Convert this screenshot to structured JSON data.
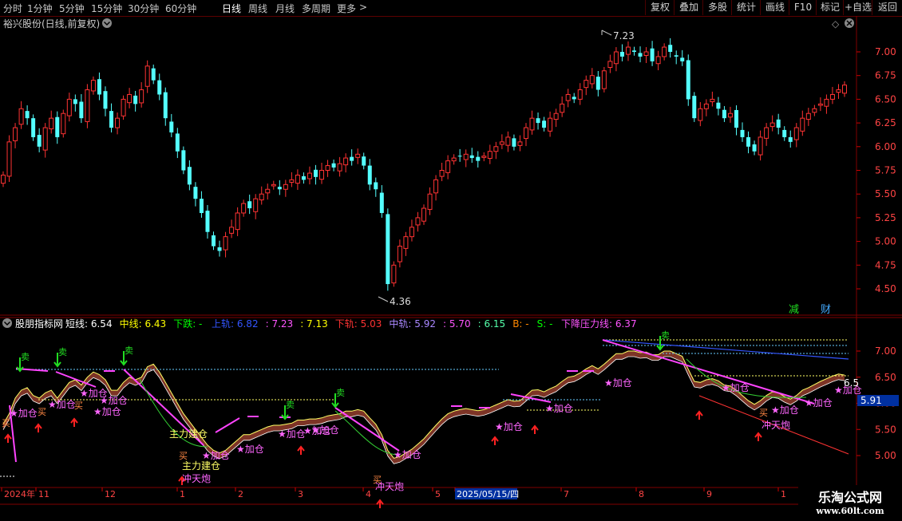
{
  "toolbar": {
    "periods": [
      "分时",
      "1分钟",
      "5分钟",
      "15分钟",
      "30分钟",
      "60分钟",
      "日线",
      "周线",
      "月线",
      "多周期",
      "更多"
    ],
    "active_period": "日线",
    "more_arrow": ">",
    "right_buttons": [
      "复权",
      "叠加",
      "多股",
      "统计",
      "画线",
      "F10",
      "标记",
      "+自选",
      "返回"
    ]
  },
  "main_panel": {
    "title": "裕兴股份(日线,前复权)",
    "high_label": "7.23",
    "low_label": "4.36",
    "axis_ticks": [
      "7.00",
      "6.75",
      "6.50",
      "6.25",
      "6.00",
      "5.75",
      "5.50",
      "5.25",
      "5.00",
      "4.75",
      "4.50"
    ],
    "markers": [
      {
        "text": "减",
        "color": "#22dd22"
      },
      {
        "text": "财",
        "color": "#44aaff"
      }
    ]
  },
  "indicator_panel": {
    "name": "股朋指标网",
    "legend": [
      {
        "label": "短线:",
        "value": "6.54",
        "color": "#ffffff"
      },
      {
        "label": "中线:",
        "value": "6.43",
        "color": "#ffff00"
      },
      {
        "label": "下跌:",
        "value": "-",
        "color": "#00ff00"
      },
      {
        "label": "上轨:",
        "value": "6.82",
        "color": "#3355ff"
      },
      {
        "label": ":",
        "value": "7.23",
        "color": "#ff55ff"
      },
      {
        "label": ":",
        "value": "7.13",
        "color": "#ffff00"
      },
      {
        "label": "下轨:",
        "value": "5.03",
        "color": "#ff3333"
      },
      {
        "label": "中轨:",
        "value": "5.92",
        "color": "#aa88ff"
      },
      {
        "label": ":",
        "value": "5.70",
        "color": "#ff55ff"
      },
      {
        "label": ":",
        "value": "6.15",
        "color": "#55ffaa"
      },
      {
        "label": "B:",
        "value": "-",
        "color": "#ff8800"
      },
      {
        "label": "S:",
        "value": "-",
        "color": "#00ff00"
      },
      {
        "label": "下降压力线:",
        "value": "6.37",
        "color": "#ff55ff"
      }
    ],
    "axis_ticks": [
      "7.00",
      "6.50",
      "6.00",
      "5.50",
      "5.00"
    ],
    "current_value": "6.5",
    "cursor_value": "5.91",
    "signals": {
      "sell": "卖",
      "buy": "买",
      "add": "★加仓",
      "build": "主力建仓",
      "rocket": "冲天炮"
    }
  },
  "time_axis": {
    "labels": [
      "2024年",
      "11",
      "12",
      "1",
      "2",
      "3",
      "4",
      "5",
      "2025/05/15/四",
      "7",
      "8",
      "9",
      "1"
    ]
  },
  "watermark": {
    "title": "乐淘公式网",
    "url": "www.60lt.com"
  },
  "colors": {
    "up": "#ff3333",
    "down": "#54ffff",
    "grid": "#800000",
    "background": "#000000"
  },
  "chart_data": {
    "type": "candlestick",
    "title": "裕兴股份(日线,前复权)",
    "ylim": [
      4.3,
      7.3
    ],
    "high": 7.23,
    "low": 4.36,
    "series": [
      {
        "name": "close",
        "values": [
          5.7,
          6.05,
          6.2,
          6.4,
          6.3,
          6.1,
          6.0,
          6.2,
          6.3,
          6.1,
          6.35,
          6.5,
          6.45,
          6.3,
          6.6,
          6.7,
          6.55,
          6.4,
          6.2,
          6.3,
          6.5,
          6.55,
          6.45,
          6.6,
          6.85,
          6.7,
          6.55,
          6.3,
          6.15,
          5.95,
          5.75,
          5.6,
          5.45,
          5.3,
          5.1,
          4.95,
          4.9,
          5.05,
          5.15,
          5.3,
          5.4,
          5.35,
          5.45,
          5.5,
          5.55,
          5.6,
          5.55,
          5.6,
          5.65,
          5.7,
          5.65,
          5.72,
          5.68,
          5.75,
          5.8,
          5.78,
          5.82,
          5.88,
          5.85,
          5.92,
          5.8,
          5.6,
          5.55,
          5.3,
          4.55,
          4.75,
          4.95,
          5.05,
          5.15,
          5.25,
          5.35,
          5.5,
          5.65,
          5.75,
          5.85,
          5.88,
          5.9,
          5.92,
          5.88,
          5.85,
          5.9,
          5.95,
          6.0,
          6.05,
          6.1,
          6.0,
          6.05,
          6.2,
          6.3,
          6.25,
          6.2,
          6.3,
          6.35,
          6.45,
          6.55,
          6.5,
          6.6,
          6.7,
          6.75,
          6.6,
          6.8,
          6.9,
          7.0,
          6.95,
          7.05,
          7.0,
          6.95,
          7.0,
          6.9,
          6.95,
          7.05,
          7.0,
          6.95,
          6.9,
          6.5,
          6.3,
          6.4,
          6.45,
          6.5,
          6.4,
          6.3,
          6.35,
          6.2,
          6.1,
          6.0,
          5.95,
          6.1,
          6.2,
          6.25,
          6.2,
          6.1,
          6.05,
          6.2,
          6.3,
          6.35,
          6.4,
          6.45,
          6.5,
          6.55,
          6.6,
          6.65
        ]
      },
      {
        "name": "短线",
        "values": [
          5.6,
          5.8,
          6.1,
          6.25,
          6.3,
          6.15,
          6.1,
          6.2,
          6.25,
          6.1,
          6.25,
          6.4,
          6.45,
          6.35,
          6.5,
          6.6,
          6.55,
          6.45,
          6.25,
          6.25,
          6.4,
          6.5,
          6.45,
          6.5,
          6.7,
          6.75,
          6.6,
          6.4,
          6.2,
          6.0,
          5.8,
          5.65,
          5.5,
          5.35,
          5.2,
          5.1,
          5.05,
          5.1,
          5.2,
          5.3,
          5.4,
          5.4,
          5.45,
          5.5,
          5.55,
          5.58,
          5.58,
          5.6,
          5.62,
          5.68,
          5.68,
          5.7,
          5.7,
          5.72,
          5.76,
          5.78,
          5.8,
          5.85,
          5.85,
          5.88,
          5.85,
          5.72,
          5.6,
          5.4,
          5.1,
          4.95,
          4.98,
          5.05,
          5.12,
          5.22,
          5.32,
          5.45,
          5.58,
          5.7,
          5.8,
          5.85,
          5.88,
          5.9,
          5.88,
          5.86,
          5.88,
          5.92,
          5.97,
          6.02,
          6.07,
          6.04,
          6.05,
          6.15,
          6.25,
          6.26,
          6.22,
          6.28,
          6.33,
          6.42,
          6.5,
          6.52,
          6.58,
          6.66,
          6.72,
          6.66,
          6.75,
          6.85,
          6.95,
          6.95,
          7.0,
          7.0,
          6.97,
          6.98,
          6.93,
          6.93,
          7.0,
          7.0,
          6.95,
          6.9,
          6.65,
          6.42,
          6.4,
          6.45,
          6.47,
          6.43,
          6.35,
          6.33,
          6.25,
          6.15,
          6.05,
          5.98,
          6.05,
          6.15,
          6.22,
          6.2,
          6.13,
          6.08,
          6.15,
          6.25,
          6.3,
          6.36,
          6.42,
          6.47,
          6.52,
          6.56,
          6.54
        ]
      }
    ],
    "indicator_values": {
      "短线": 6.54,
      "中线": 6.43,
      "上轨": 6.82,
      "下轨": 5.03,
      "中轨": 5.92,
      "下降压力线": 6.37
    }
  }
}
